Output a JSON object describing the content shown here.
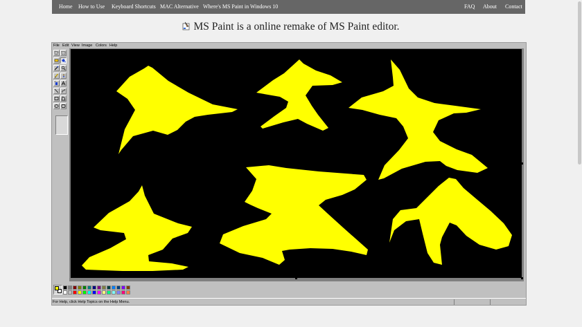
{
  "nav": {
    "left": [
      "Home",
      "How to Use",
      "Keyboard Shortcuts",
      "MAC Alternative",
      "Where's MS Paint in Windows 10"
    ],
    "right": [
      "FAQ",
      "About",
      "Contact"
    ]
  },
  "headline": "MS Paint is a online remake of MS Paint editor.",
  "menubar": [
    "File",
    "Edit",
    "View",
    "Image",
    "Colors",
    "Help"
  ],
  "tools": [
    "free-form-select",
    "select",
    "eraser",
    "fill",
    "color-picker",
    "magnifier",
    "pencil",
    "brush",
    "airbrush",
    "text",
    "line",
    "curve",
    "rectangle",
    "polygon",
    "ellipse",
    "rounded-rectangle"
  ],
  "colors": {
    "foreground": "#ffff00",
    "background": "#ffffff",
    "canvas": "#000000",
    "paint": "#ffff00",
    "palette_top": [
      "#000000",
      "#808080",
      "#800000",
      "#808000",
      "#008000",
      "#008080",
      "#000080",
      "#800080",
      "#808040",
      "#004040",
      "#0080ff",
      "#004080",
      "#8000ff",
      "#804000"
    ],
    "palette_bottom": [
      "#ffffff",
      "#c0c0c0",
      "#ff0000",
      "#ffff00",
      "#00ff00",
      "#00ffff",
      "#0000ff",
      "#ff00ff",
      "#ffff80",
      "#00ff80",
      "#80ffff",
      "#8080ff",
      "#ff0080",
      "#ff8040"
    ]
  },
  "status": "For Help, click Help Topics on the Help Menu."
}
